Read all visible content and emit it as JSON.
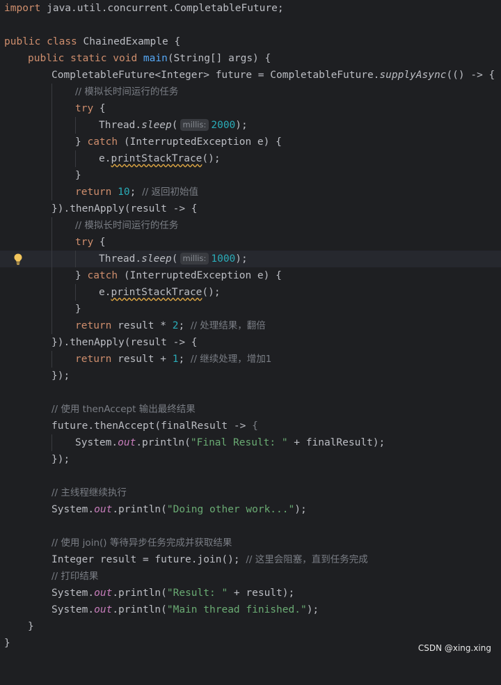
{
  "editor": {
    "lines": {
      "l1": [
        "import",
        " java.util.concurrent.CompletableFuture;"
      ],
      "l3": [
        "public",
        " ",
        "class",
        " ChainedExample {"
      ],
      "l4": [
        "public",
        " ",
        "static",
        " ",
        "void",
        " ",
        "main",
        "(String[] args) {"
      ],
      "l5": [
        "CompletableFuture<Integer> future = CompletableFuture.",
        "supplyAsync",
        "(() -> {"
      ],
      "l6": "// 模拟长时间运行的任务",
      "l7": [
        "try",
        " {"
      ],
      "l8": [
        "Thread.",
        "sleep",
        "(",
        "millis:",
        "2000",
        ");"
      ],
      "l9": [
        "} ",
        "catch",
        " (InterruptedException e) {"
      ],
      "l10": [
        "e.",
        "printStackTrace",
        "();"
      ],
      "l11": "}",
      "l12": [
        "return",
        " ",
        "10",
        "; ",
        "// 返回初始值"
      ],
      "l13": [
        "}).thenApply(result -> {"
      ],
      "l14": "// 模拟长时间运行的任务",
      "l15": [
        "try",
        " {"
      ],
      "l16": [
        "Thread.",
        "sleep",
        "(",
        "millis:",
        "1000",
        ");"
      ],
      "l17": [
        "} ",
        "catch",
        " (InterruptedException e) {"
      ],
      "l18": [
        "e.",
        "printStackTrace",
        "();"
      ],
      "l19": "}",
      "l20": [
        "return",
        " result * ",
        "2",
        "; ",
        "// 处理结果，翻倍"
      ],
      "l21": [
        "}).thenApply(result -> {"
      ],
      "l22": [
        "return",
        " result + ",
        "1",
        "; ",
        "// 继续处理，增加1"
      ],
      "l23": "});",
      "l25": "// 使用 thenAccept 输出最终结果",
      "l26": [
        "future.thenAccept(finalResult -> ",
        "{"
      ],
      "l27": [
        "System.",
        "out",
        ".println(",
        "\"Final Result: \"",
        " + finalResult);"
      ],
      "l28": "});",
      "l30": "// 主线程继续执行",
      "l31": [
        "System.",
        "out",
        ".println(",
        "\"Doing other work...\"",
        ");"
      ],
      "l33": "// 使用 join() 等待异步任务完成并获取结果",
      "l34": [
        "Integer result = future.join(); ",
        "// 这里会阻塞，直到任务完成"
      ],
      "l35": "// 打印结果",
      "l36": [
        "System.",
        "out",
        ".println(",
        "\"Result: \"",
        " + result);"
      ],
      "l37": [
        "System.",
        "out",
        ".println(",
        "\"Main thread finished.\"",
        ");"
      ],
      "l38": "}",
      "l39": "}"
    }
  },
  "icons": {
    "bulb": "lightbulb-icon"
  },
  "colors": {
    "background": "#1e1f22",
    "keyword": "#cf8e6d",
    "function": "#56a8f5",
    "number": "#2aacb8",
    "string": "#6aab73",
    "comment": "#7a7e85",
    "static_field": "#c77dbb"
  },
  "watermark": "CSDN @xing.xing"
}
